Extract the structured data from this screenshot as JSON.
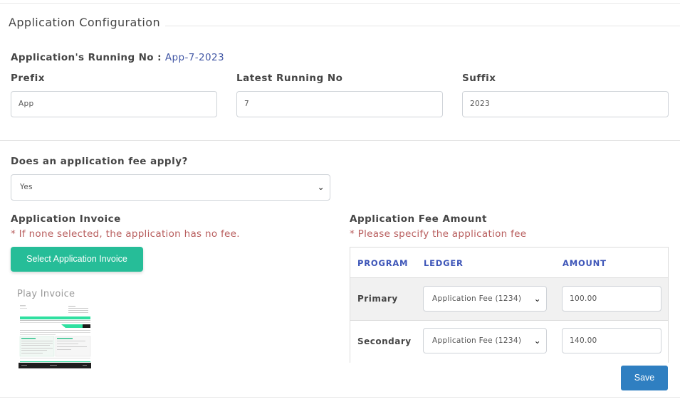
{
  "section": {
    "title": "Application Configuration"
  },
  "running_no": {
    "label": "Application's Running No :",
    "value": "App-7-2023"
  },
  "fields": {
    "prefix": {
      "label": "Prefix",
      "value": "App"
    },
    "latest": {
      "label": "Latest Running No",
      "value": "7"
    },
    "suffix": {
      "label": "Suffix",
      "value": "2023"
    }
  },
  "fee_apply": {
    "label": "Does an application fee apply?",
    "selected": "Yes"
  },
  "invoice": {
    "label": "Application Invoice",
    "note": "* If none selected, the application has no fee.",
    "button": "Select Application Invoice",
    "selected_name": "Play Invoice"
  },
  "fee_amount": {
    "label": "Application Fee Amount",
    "note": "* Please specify the application fee",
    "headers": {
      "program": "PROGRAM",
      "ledger": "LEDGER",
      "amount": "AMOUNT"
    },
    "rows": [
      {
        "program": "Primary",
        "ledger": "Application Fee (1234)",
        "amount": "100.00"
      },
      {
        "program": "Secondary",
        "ledger": "Application Fee (1234)",
        "amount": "140.00"
      }
    ]
  },
  "actions": {
    "save": "Save"
  },
  "icons": {
    "select_arrow": "chevron-down-icon"
  },
  "colors": {
    "accent_green": "#26bd98",
    "save_blue": "#2f7fc1",
    "header_blue": "#3d55b8",
    "note_red": "#b85d5d",
    "link_blue": "#4257a5"
  }
}
